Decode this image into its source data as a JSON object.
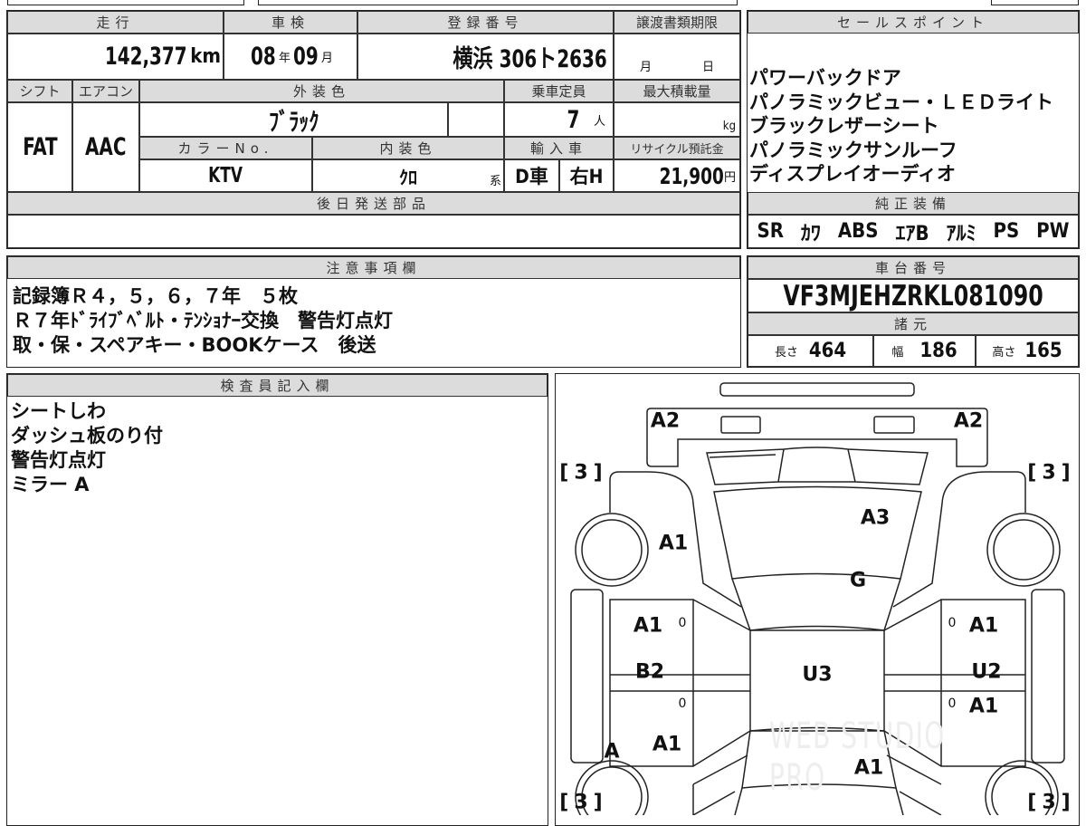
{
  "top": {
    "headers": {
      "mileage": "走行",
      "inspection": "車検",
      "registration": "登録番号",
      "transfer_deadline": "譲渡書類期限",
      "shift": "シフト",
      "aircon": "エアコン",
      "exterior_color": "外装色",
      "capacity": "乗車定員",
      "max_load": "最大積載量",
      "color_no": "カラーNo.",
      "interior_color": "内装色",
      "import": "輸入車",
      "recycle": "リサイクル預託金",
      "later_parts": "後日発送部品"
    },
    "mileage": "142,377",
    "mileage_unit": "km",
    "inspection_year": "08",
    "year_unit": "年",
    "inspection_month": "09",
    "month_unit": "月",
    "registration": "横浜 306ト2636",
    "transfer_month": "月",
    "transfer_day": "日",
    "shift": "FAT",
    "aircon": "AAC",
    "exterior_color": "ﾌﾞﾗｯｸ",
    "capacity": "7",
    "capacity_unit": "人",
    "load_unit": "kg",
    "color_no": "KTV",
    "interior_color": "ｸﾛ",
    "interior_suffix": "系",
    "import_type": "D車",
    "steering": "右H",
    "recycle": "21,900",
    "recycle_unit": "円"
  },
  "sales_points": {
    "header": "セールスポイント",
    "items": [
      "パワーバックドア",
      "パノラミックビュー・ＬＥＤライト",
      "ブラックレザーシート",
      "パノラミックサンルーフ",
      "ディスプレイオーディオ"
    ]
  },
  "equipment": {
    "header": "純正装備",
    "items": [
      "SR",
      "ｶﾜ",
      "ABS",
      "ｴｱB",
      "ｱﾙﾐ",
      "PS",
      "PW"
    ]
  },
  "notes": {
    "header": "注意事項欄",
    "lines": [
      "記録簿Ｒ４，５，６，７年　５枚",
      "Ｒ７年ﾄﾞﾗｲﾌﾞﾍﾞﾙﾄ・ﾃﾝｼｮﾅｰ交換　警告灯点灯",
      "取・保・スペアキー・BOOKケース　後送"
    ]
  },
  "chassis": {
    "header": "車台番号",
    "value": "VF3MJEHZRKL081090"
  },
  "specs": {
    "header": "諸元",
    "length_label": "長さ",
    "length": "464",
    "width_label": "幅",
    "width": "186",
    "height_label": "高さ",
    "height": "165"
  },
  "inspector": {
    "header": "検査員記入欄",
    "lines": [
      "シートしわ",
      "ダッシュ板のり付",
      "警告灯点灯",
      "ミラー A"
    ]
  },
  "diagram": {
    "marks": [
      "A2",
      "A2",
      "3",
      "3",
      "A3",
      "A1",
      "G",
      "A1",
      "A1",
      "B2",
      "U3",
      "U2",
      "A1",
      "A",
      "A1",
      "A1",
      "3",
      "3"
    ],
    "zero": "0",
    "watermark": "WEB STUDIO PRO"
  }
}
